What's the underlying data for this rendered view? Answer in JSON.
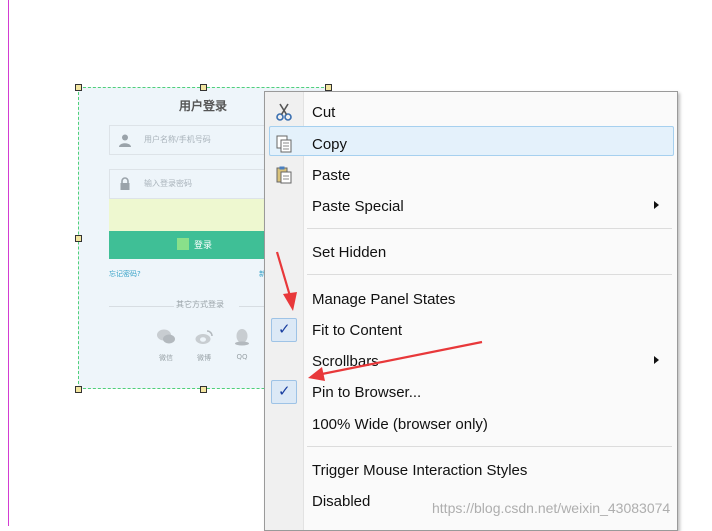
{
  "login_form": {
    "title": "用户登录",
    "username_placeholder": "用户名称/手机号码",
    "password_placeholder": "输入登录密码",
    "login_button": "登录",
    "forgot_password": "忘记密码?",
    "register": "新",
    "other_methods": "其它方式登录",
    "social": [
      {
        "label": "微信",
        "icon": "wechat-icon"
      },
      {
        "label": "微博",
        "icon": "weibo-icon"
      },
      {
        "label": "QQ",
        "icon": "qq-icon"
      }
    ]
  },
  "context_menu": {
    "items": {
      "cut": "Cut",
      "copy": "Copy",
      "paste": "Paste",
      "paste_special": "Paste Special",
      "set_hidden": "Set Hidden",
      "manage_panel_states": "Manage Panel States",
      "fit_to_content": "Fit to Content",
      "scrollbars": "Scrollbars",
      "pin_to_browser": "Pin to Browser...",
      "wide_100": "100% Wide (browser only)",
      "trigger_mouse": "Trigger Mouse Interaction Styles",
      "disabled": "Disabled"
    },
    "checked": [
      "fit_to_content",
      "pin_to_browser"
    ],
    "highlighted": "copy"
  },
  "watermark": "https://blog.csdn.net/weixin_43083074",
  "colors": {
    "accent_green": "#3fbf96",
    "annotation_arrow": "#e8383a",
    "selection_border": "#4fd07a",
    "guide_line": "#d23cd2"
  }
}
